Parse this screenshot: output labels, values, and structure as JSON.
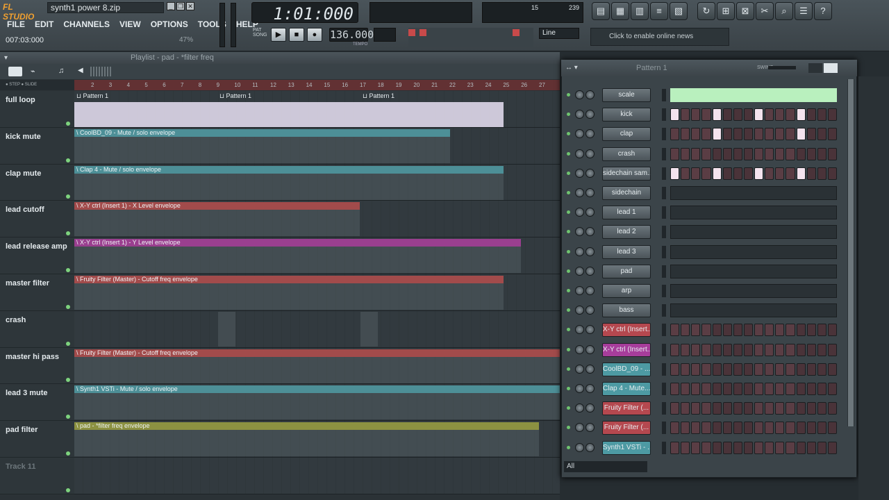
{
  "app": {
    "logo": "FL STUDIO",
    "filename": "synth1 power 8.zip"
  },
  "menu": [
    "FILE",
    "EDIT",
    "CHANNELS",
    "VIEW",
    "OPTIONS",
    "TOOLS",
    "HELP"
  ],
  "hint": {
    "time": "007:03:000",
    "percent": "47%"
  },
  "lcd": {
    "time": "1:01:000"
  },
  "tempo": {
    "value": "136.000",
    "label": "TEMPO"
  },
  "cpu": {
    "poly": "15",
    "mem": "239"
  },
  "snap": "Line",
  "news": "Click to enable online news",
  "playlist": {
    "title": "Playlist - pad - *filter freq",
    "ruler": [
      "2",
      "3",
      "4",
      "5",
      "6",
      "7",
      "8",
      "9",
      "10",
      "11",
      "12",
      "13",
      "14",
      "15",
      "16",
      "17",
      "18",
      "19",
      "20",
      "21",
      "22",
      "23",
      "24",
      "25",
      "26",
      "27"
    ],
    "tracks": [
      {
        "name": "full loop",
        "clips": [
          {
            "label": "Pattern 1"
          },
          {
            "label": "Pattern 1"
          },
          {
            "label": "Pattern 1"
          }
        ],
        "color": "#e9e2f5"
      },
      {
        "name": "kick mute",
        "clip": "CoolBD_09 - Mute / solo envelope",
        "color": "#4d8f97"
      },
      {
        "name": "clap mute",
        "clip": "Clap 4 - Mute / solo envelope",
        "color": "#4d8f97"
      },
      {
        "name": "lead cutoff",
        "clip": "X-Y ctrl (Insert 1) - X Level envelope",
        "color": "#a24b4b"
      },
      {
        "name": "lead release amp",
        "clip": "X-Y ctrl (Insert 1) - Y Level envelope",
        "color": "#9a3f8f"
      },
      {
        "name": "master filter",
        "clip": "Fruity Filter (Master) - Cutoff freq envelope",
        "color": "#a24b4b"
      },
      {
        "name": "crash",
        "clip": "",
        "color": "#4a5257"
      },
      {
        "name": "master hi pass",
        "clip": "Fruity Filter (Master) - Cutoff freq envelope",
        "color": "#a24b4b"
      },
      {
        "name": "lead 3 mute",
        "clip": "Synth1 VSTi - Mute / solo envelope",
        "color": "#4d8f97"
      },
      {
        "name": "pad filter",
        "clip": "pad - *filter freq envelope",
        "color": "#8c9141"
      },
      {
        "name": "Track 11",
        "clip": "",
        "color": "#4a5257"
      }
    ]
  },
  "channelrack": {
    "title": "Pattern 1",
    "swing": "SWING",
    "filter": "All",
    "channels": [
      {
        "name": "scale",
        "kind": "bar"
      },
      {
        "name": "kick",
        "kind": "steps",
        "on": [
          0,
          4,
          8,
          12
        ]
      },
      {
        "name": "clap",
        "kind": "steps",
        "on": [
          4,
          12
        ]
      },
      {
        "name": "crash",
        "kind": "steps",
        "on": []
      },
      {
        "name": "sidechain sam...",
        "kind": "steps",
        "on": [
          0,
          4,
          8,
          12
        ]
      },
      {
        "name": "sidechain",
        "kind": "roll"
      },
      {
        "name": "lead 1",
        "kind": "roll"
      },
      {
        "name": "lead 2",
        "kind": "roll"
      },
      {
        "name": "lead 3",
        "kind": "roll"
      },
      {
        "name": "pad",
        "kind": "roll"
      },
      {
        "name": "arp",
        "kind": "roll"
      },
      {
        "name": "bass",
        "kind": "roll"
      },
      {
        "name": "X-Y ctrl (Insert...",
        "kind": "steps",
        "on": [],
        "color": "#b5484f"
      },
      {
        "name": "X-Y ctrl (Insert...",
        "kind": "steps",
        "on": [],
        "color": "#a73d9b"
      },
      {
        "name": "CoolBD_09 - ...",
        "kind": "steps",
        "on": [],
        "color": "#4d9aa3"
      },
      {
        "name": "Clap 4 - Mute...",
        "kind": "steps",
        "on": [],
        "color": "#4d9aa3"
      },
      {
        "name": "Fruity Filter (...",
        "kind": "steps",
        "on": [],
        "color": "#b5484f"
      },
      {
        "name": "Fruity Filter (...",
        "kind": "steps",
        "on": [],
        "color": "#b5484f"
      },
      {
        "name": "Synth1 VSTi - ...",
        "kind": "steps",
        "on": [],
        "color": "#4d9aa3"
      }
    ]
  }
}
